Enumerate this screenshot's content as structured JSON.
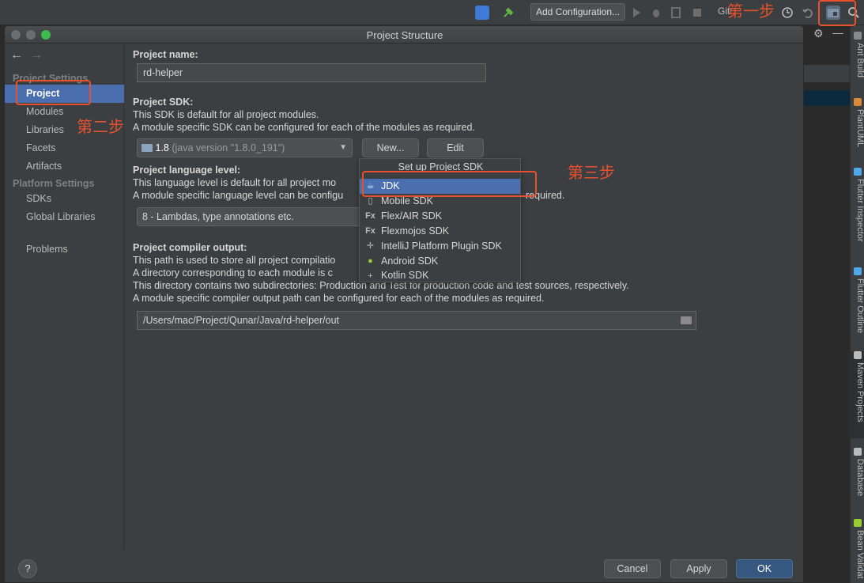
{
  "toolbar": {
    "add_configuration": "Add Configuration...",
    "git": "Git:"
  },
  "right_strip": {
    "tabs": [
      "Ant Build",
      "PlantUML",
      "Flutter Inspector",
      "Flutter Outline",
      "Maven Projects",
      "Database",
      "Bean Validat"
    ]
  },
  "dialog": {
    "title": "Project Structure"
  },
  "sidebar": {
    "back_icon": "←",
    "forward_icon": "→",
    "project_settings_title": "Project Settings",
    "project_settings_items": [
      "Project",
      "Modules",
      "Libraries",
      "Facets",
      "Artifacts"
    ],
    "platform_settings_title": "Platform Settings",
    "platform_settings_items": [
      "SDKs",
      "Global Libraries"
    ],
    "problems": "Problems"
  },
  "content": {
    "project_name_label": "Project name:",
    "project_name_value": "rd-helper",
    "sdk_label": "Project SDK:",
    "sdk_desc1": "This SDK is default for all project modules.",
    "sdk_desc2": "A module specific SDK can be configured for each of the modules as required.",
    "sdk_value": "1.8",
    "sdk_version": "(java version \"1.8.0_191\")",
    "new_button": "New...",
    "edit_button": "Edit",
    "lang_label": "Project language level:",
    "lang_desc1": "This language level is default for all project mo",
    "lang_desc2": "A module specific language level can be configu",
    "lang_desc2_tail": "required.",
    "lang_value": "8 - Lambdas, type annotations etc.",
    "compiler_label": "Project compiler output:",
    "compiler_desc1": "This path is used to store all project compilatio",
    "compiler_desc2": "A directory corresponding to each module is c",
    "compiler_desc3": "This directory contains two subdirectories: Production and Test for production code and test sources, respectively.",
    "compiler_desc4": "A module specific compiler output path can be configured for each of the modules as required.",
    "compiler_path": "/Users/mac/Project/Qunar/Java/rd-helper/out"
  },
  "popup": {
    "title": "Set up Project SDK",
    "items": [
      {
        "label": "JDK",
        "icon": "jdk-icon"
      },
      {
        "label": "Mobile SDK",
        "icon": "mobile-icon"
      },
      {
        "label": "Flex/AIR SDK",
        "icon": "flex-icon"
      },
      {
        "label": "Flexmojos SDK",
        "icon": "flexmojos-icon"
      },
      {
        "label": "IntelliJ Platform Plugin SDK",
        "icon": "plugin-icon"
      },
      {
        "label": "Android SDK",
        "icon": "android-icon"
      },
      {
        "label": "Kotlin SDK",
        "icon": "plus-icon"
      }
    ]
  },
  "footer": {
    "help": "?",
    "cancel": "Cancel",
    "apply": "Apply",
    "ok": "OK"
  },
  "annotations": {
    "step1": "第一步",
    "step2": "第二步",
    "step3": "第三步"
  },
  "colors": {
    "accent": "#4b6eaf",
    "annotation": "#e8502e",
    "background": "#3c3f41"
  }
}
